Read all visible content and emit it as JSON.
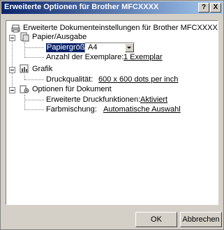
{
  "window": {
    "title": "Erweiterte Optionen für Brother MFCXXXX",
    "help_label": "?",
    "close_label": "X"
  },
  "tree": {
    "root": "Erweiterte Dokumenteinstellungen für Brother MFCXXXX",
    "paper": {
      "label": "Papier/Ausgabe",
      "paper_size_label": "Papiergröße:",
      "paper_size_value": "A4",
      "copies_label": "Anzahl der Exemplare:",
      "copies_value": "1 Exemplar"
    },
    "graphics": {
      "label": "Grafik",
      "quality_label": "Druckqualität:",
      "quality_value": "600 x 600 dots per inch"
    },
    "document": {
      "label": "Optionen für Dokument",
      "advanced_label": "Erweiterte Druckfunktionen:",
      "advanced_value": "Aktiviert",
      "color_label": "Farbmischung:",
      "color_value": "Automatische Auswahl"
    }
  },
  "buttons": {
    "ok": "OK",
    "cancel": "Abbrechen"
  }
}
